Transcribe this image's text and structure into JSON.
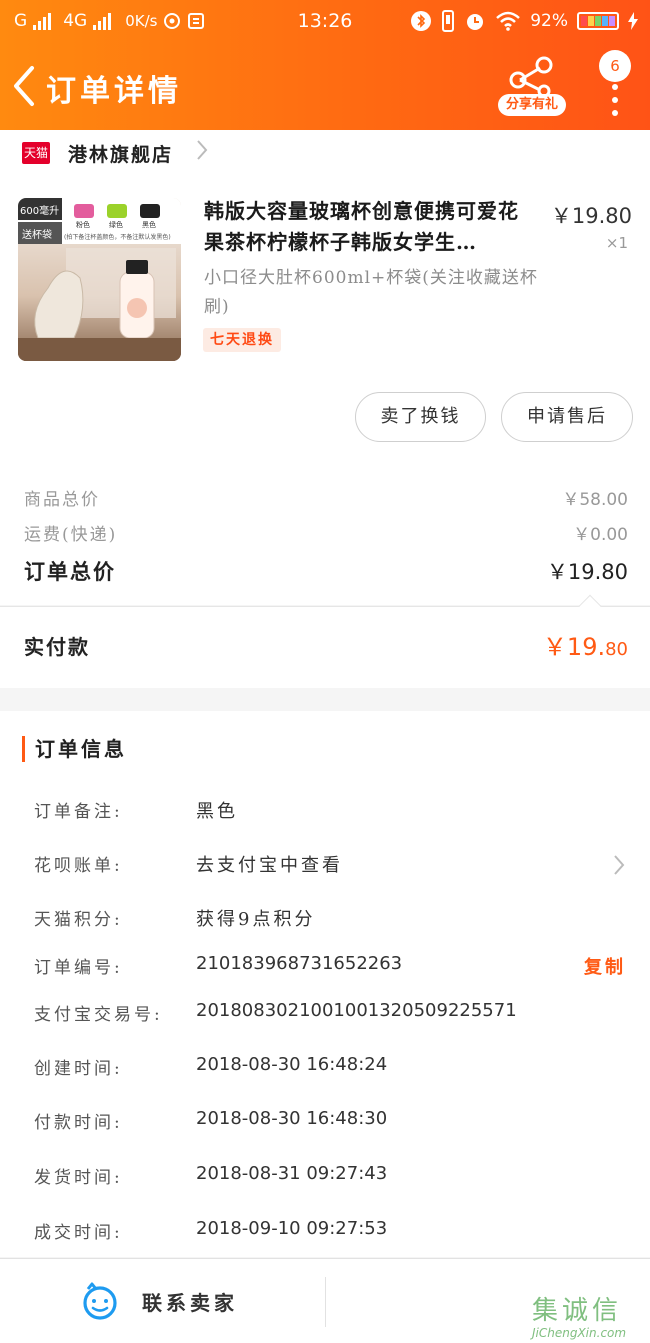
{
  "status_bar": {
    "carrier": "G",
    "network": "4G",
    "speed": "0K/s",
    "time": "13:26",
    "battery": "92%"
  },
  "header": {
    "title": "订单详情",
    "share_label": "分享有礼",
    "badge_count": "6"
  },
  "store": {
    "badge": "天猫",
    "name": "港林旗舰店"
  },
  "product": {
    "name": "韩版大容量玻璃杯创意便携可爱花果茶杯柠檬杯子韩版女学生…",
    "sku": "小口径大肚杯600ml+杯袋(关注收藏送杯刷)",
    "price": "￥19.80",
    "quantity": "×1",
    "tag": "七天退换",
    "thumbnail": {
      "corner_label": "600毫升",
      "badge": "送杯袋",
      "color_options": [
        "粉色",
        "绿色",
        "黑色"
      ],
      "note": "(拍下备注杯盖颜色，不备注默认发黑色)",
      "colors": {
        "pink": "#e35d9d",
        "green": "#9bd22a",
        "black": "#222222"
      }
    }
  },
  "actions": {
    "sell_button": "卖了换钱",
    "aftersale_button": "申请售后"
  },
  "summary": {
    "goods_total_label": "商品总价",
    "goods_total": "￥58.00",
    "shipping_label": "运费(快递)",
    "shipping": "￥0.00",
    "order_total_label": "订单总价",
    "order_total": "￥19.80"
  },
  "payment": {
    "label": "实付款",
    "amount_main": "￥19.",
    "amount_cents": "80"
  },
  "order_info": {
    "title": "订单信息",
    "rows": [
      {
        "label": "订单备注:",
        "value": "黑色"
      },
      {
        "label": "花呗账单:",
        "value": "去支付宝中查看"
      },
      {
        "label": "天猫积分:",
        "value": "获得9点积分"
      },
      {
        "label": "订单编号:",
        "value": "210183968731652263"
      },
      {
        "label": "支付宝交易号:",
        "value": "2018083021001001320509225571"
      },
      {
        "label": "创建时间:",
        "value": "2018-08-30 16:48:24"
      },
      {
        "label": "付款时间:",
        "value": "2018-08-30 16:48:30"
      },
      {
        "label": "发货时间:",
        "value": "2018-08-31 09:27:43"
      },
      {
        "label": "成交时间:",
        "value": "2018-09-10 09:27:53"
      }
    ],
    "copy_label": "复制"
  },
  "bottom_bar": {
    "contact_label": "联系卖家"
  },
  "watermark": {
    "cn": "集诚信",
    "en": "JiChengXin.com"
  },
  "colors": {
    "accent": "#ff5a14",
    "header_start": "#ff8a10",
    "header_end": "#ff5316",
    "tmall_red": "#e4002b"
  }
}
